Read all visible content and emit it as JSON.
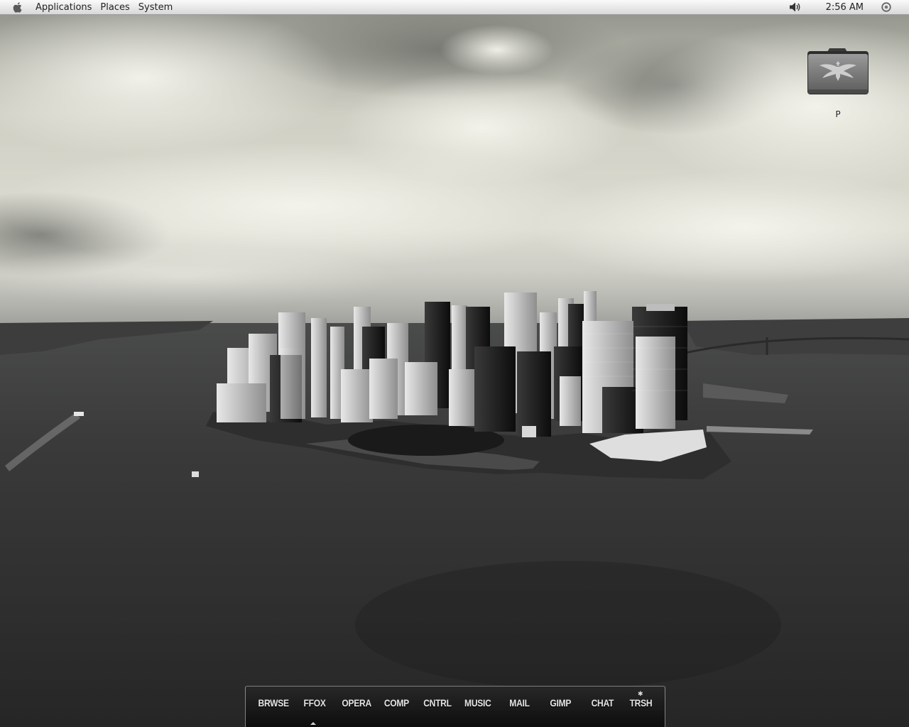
{
  "top_panel": {
    "menus": {
      "applications": "Applications",
      "places": "Places",
      "system": "System"
    },
    "clock": "2:56 AM",
    "icons": {
      "menu_logo": "apple-icon",
      "volume": "volume-icon",
      "session": "session-icon"
    }
  },
  "desktop": {
    "icons": [
      {
        "label": "P",
        "icon": "folder-eagle-icon"
      }
    ]
  },
  "dock": {
    "items": [
      {
        "label": "BRWSE"
      },
      {
        "label": "FFOX"
      },
      {
        "label": "OPERA"
      },
      {
        "label": "COMP"
      },
      {
        "label": "CNTRL"
      },
      {
        "label": "MUSIC"
      },
      {
        "label": "MAIL"
      },
      {
        "label": "GIMP"
      },
      {
        "label": "CHAT"
      },
      {
        "label": "TRSH"
      }
    ]
  },
  "colors": {
    "panel_bg": "#e6e6e6",
    "dock_text": "#e4e4e4"
  }
}
